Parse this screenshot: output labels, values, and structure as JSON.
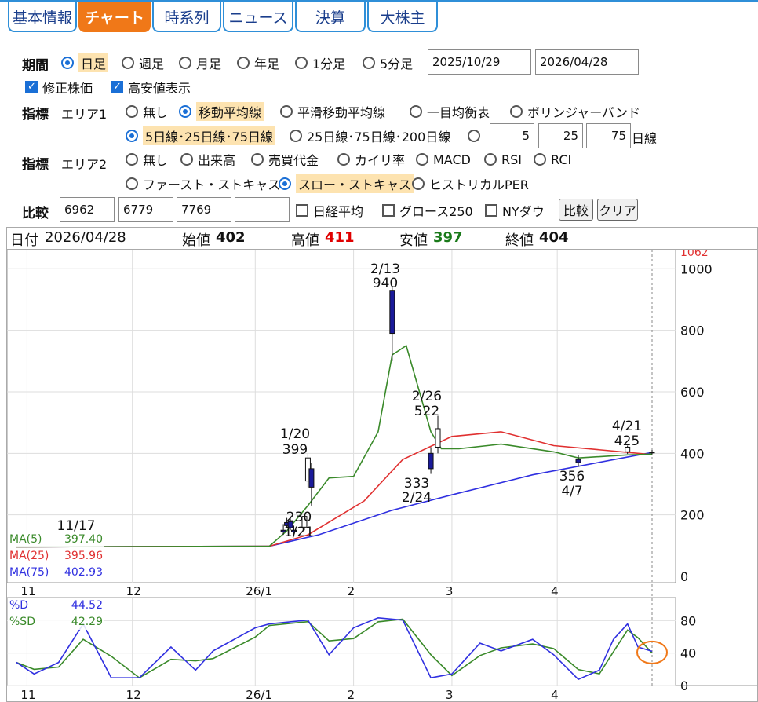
{
  "tabs": [
    "基本情報",
    "チャート",
    "時系列",
    "ニュース",
    "決算",
    "大株主"
  ],
  "period": {
    "label": "期間",
    "options": [
      "日足",
      "週足",
      "月足",
      "年足",
      "1分足",
      "5分足"
    ],
    "start": "2025/10/29",
    "end": "2026/04/28"
  },
  "checks": {
    "adjusted": "修正株価",
    "highlow": "高安値表示"
  },
  "ind1": {
    "label": "指標",
    "area": "エリア1",
    "options": [
      "無し",
      "移動平均線",
      "平滑移動平均線",
      "一目均衡表",
      "ボリンジャーバンド"
    ],
    "sub": [
      "5日線･25日線･75日線",
      "25日線･75日線･200日線"
    ],
    "v1": "5",
    "v2": "25",
    "v3": "75",
    "unit": "日線"
  },
  "ind2": {
    "label": "指標",
    "area": "エリア2",
    "options": [
      "無し",
      "出来高",
      "売買代金",
      "カイリ率",
      "MACD",
      "RSI",
      "RCI"
    ],
    "options2": [
      "ファースト・ストキャス",
      "スロー・ストキャス",
      "ヒストリカルPER"
    ]
  },
  "compare": {
    "label": "比較",
    "codes": [
      "6962",
      "6779",
      "7769",
      ""
    ],
    "options": [
      "日経平均",
      "グロース250",
      "NYダウ"
    ],
    "btn": "比較",
    "clear": "クリア"
  },
  "info": {
    "date_label": "日付",
    "date": "2026/04/28",
    "open_label": "始値",
    "open": "402",
    "high_label": "高値",
    "high": "411",
    "low_label": "安値",
    "low": "397",
    "close_label": "終値",
    "close": "404"
  },
  "colors": {
    "high": "#e00000",
    "low": "#1a7a1a",
    "up": "#ffffff",
    "down": "#1a1a9a",
    "ma5": "#3a8a2a",
    "ma25": "#e03030",
    "ma75": "#3030e0"
  },
  "main_axis": {
    "ticks": [
      "0",
      "200",
      "400",
      "600",
      "800",
      "1000"
    ],
    "top_label": "1062"
  },
  "months": [
    "11",
    "12",
    "26/1",
    "2",
    "3",
    "4"
  ],
  "ma_legend": [
    {
      "name": "MA(5)",
      "value": "397.40"
    },
    {
      "name": "MA(25)",
      "value": "395.96"
    },
    {
      "name": "MA(75)",
      "value": "402.93"
    }
  ],
  "stoch_legend": [
    {
      "name": "%D",
      "value": "44.52"
    },
    {
      "name": "%SD",
      "value": "42.29"
    }
  ],
  "stoch_axis": [
    "0",
    "40",
    "80"
  ],
  "annotations": [
    {
      "date": "11/17"
    },
    {
      "date": "1/20",
      "value": "399"
    },
    {
      "value": "230",
      "date": "1/21"
    },
    {
      "date": "2/13",
      "value": "940"
    },
    {
      "date": "2/26",
      "value": "522"
    },
    {
      "value": "333",
      "date": "2/24"
    },
    {
      "value": "356",
      "date": "4/7"
    },
    {
      "date": "4/21",
      "value": "425"
    }
  ],
  "chart_data": {
    "type": "candlestick",
    "x_start": "2025/10/29",
    "x_end": "2026/04/28",
    "ylim": [
      0,
      1062
    ],
    "candles": [
      {
        "date": "2026/01/13",
        "o": 150,
        "h": 170,
        "l": 135,
        "c": 145
      },
      {
        "date": "2026/01/14",
        "o": 175,
        "h": 190,
        "l": 160,
        "c": 165
      },
      {
        "date": "2026/01/15",
        "o": 178,
        "h": 195,
        "l": 150,
        "c": 158
      },
      {
        "date": "2026/01/16",
        "o": 150,
        "h": 165,
        "l": 130,
        "c": 145
      },
      {
        "date": "2026/01/19",
        "o": 160,
        "h": 200,
        "l": 150,
        "c": 195
      },
      {
        "date": "2026/01/20",
        "o": 310,
        "h": 399,
        "l": 290,
        "c": 385
      },
      {
        "date": "2026/01/21",
        "o": 350,
        "h": 370,
        "l": 230,
        "c": 290
      },
      {
        "date": "2026/02/13",
        "o": 930,
        "h": 940,
        "l": 700,
        "c": 790
      },
      {
        "date": "2026/02/24",
        "o": 400,
        "h": 420,
        "l": 333,
        "c": 350
      },
      {
        "date": "2026/02/26",
        "o": 420,
        "h": 522,
        "l": 400,
        "c": 480
      },
      {
        "date": "2026/04/07",
        "o": 380,
        "h": 395,
        "l": 356,
        "c": 370
      },
      {
        "date": "2026/04/21",
        "o": 405,
        "h": 425,
        "l": 398,
        "c": 420
      },
      {
        "date": "2026/04/28",
        "o": 402,
        "h": 411,
        "l": 397,
        "c": 404
      }
    ],
    "series": [
      {
        "name": "MA(5)",
        "last": 397.4
      },
      {
        "name": "MA(25)",
        "last": 395.96
      },
      {
        "name": "MA(75)",
        "last": 402.93
      },
      {
        "name": "%D",
        "last": 44.52
      },
      {
        "name": "%SD",
        "last": 42.29
      }
    ]
  }
}
